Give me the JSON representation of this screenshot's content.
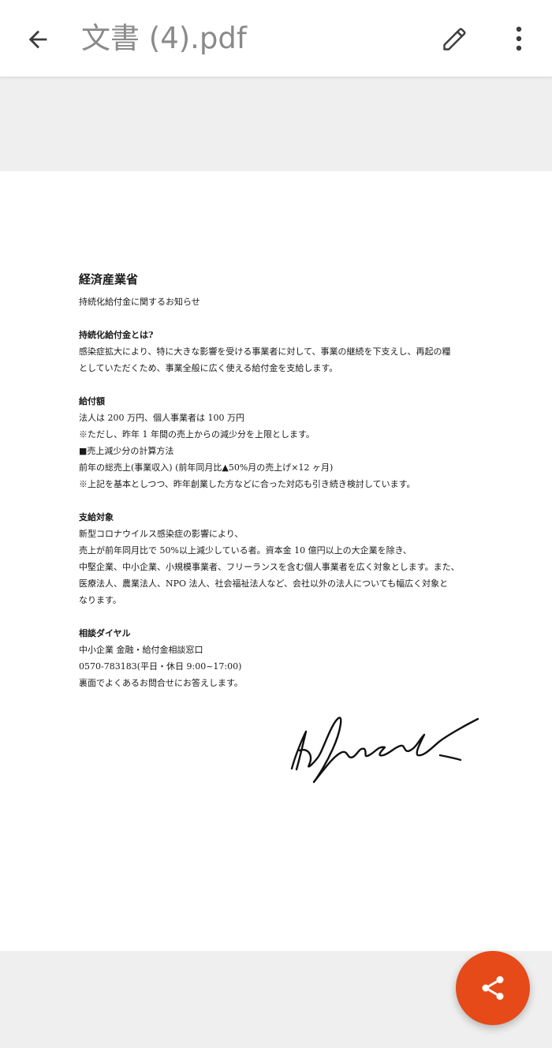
{
  "app_bar": {
    "title": "文書 (4).pdf",
    "back_icon": "arrow-left-icon",
    "edit_icon": "pencil-icon",
    "more_icon": "more-vertical-icon"
  },
  "document": {
    "title": "経済産業省",
    "subtitle": "持続化給付金に関するお知らせ",
    "sections": [
      {
        "heading": "持続化給付金とは?",
        "lines": [
          "感染症拡大により、特に大きな影響を受ける事業者に対して、事業の継続を下支えし、再起の糧",
          "としていただくため、事業全般に広く使える給付金を支給します。"
        ]
      },
      {
        "heading": "給付額",
        "lines": [
          "法人は 200 万円、個人事業者は 100 万円",
          "※ただし、昨年 1 年間の売上からの減少分を上限とします。",
          "■売上減少分の計算方法",
          "前年の総売上(事業収入) (前年同月比▲50%月の売上げ×12 ヶ月)",
          "※上記を基本としつつ、昨年創業した方などに合った対応も引き続き検討しています。"
        ]
      },
      {
        "heading": "支給対象",
        "lines": [
          "新型コロナウイルス感染症の影響により、",
          "売上が前年同月比で 50%以上減少している者。資本金 10 億円以上の大企業を除き、",
          "中堅企業、中小企業、小規模事業者、フリーランスを含む個人事業者を広く対象とします。また、",
          "医療法人、農業法人、NPO 法人、社会福祉法人など、会社以外の法人についても幅広く対象と",
          "なります。"
        ]
      },
      {
        "heading": "相談ダイヤル",
        "lines": [
          "中小企業 金融・給付金相談窓口",
          "0570-783183(平日・休日 9:00~17:00)",
          "裏面でよくあるお問合せにお答えします。"
        ]
      }
    ]
  },
  "fab": {
    "icon": "share-icon",
    "color": "#e64a19"
  },
  "colors": {
    "app_bar_bg": "#ffffff",
    "viewer_bg": "#efefef",
    "title_text": "#8a8a8a",
    "accent": "#e64a19"
  }
}
